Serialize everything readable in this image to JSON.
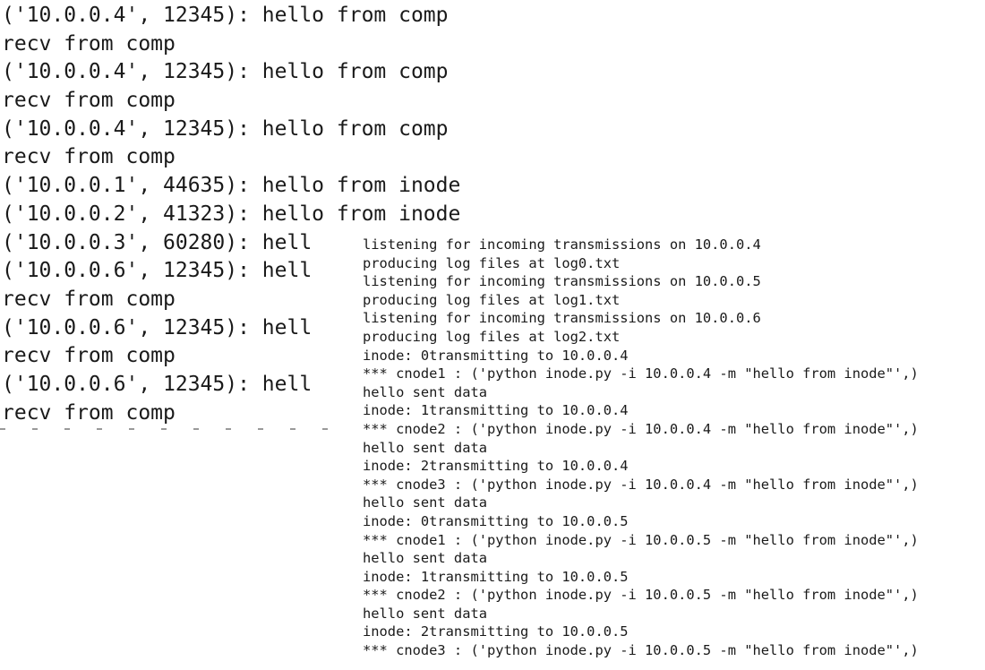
{
  "left_terminal": {
    "lines": [
      "('10.0.0.4', 12345): hello from comp",
      "recv from comp",
      "('10.0.0.4', 12345): hello from comp",
      "recv from comp",
      "('10.0.0.4', 12345): hello from comp",
      "recv from comp",
      "('10.0.0.1', 44635): hello from inode",
      "('10.0.0.2', 41323): hello from inode",
      "('10.0.0.3', 60280): hell",
      "('10.0.0.6', 12345): hell",
      "recv from comp",
      "('10.0.0.6', 12345): hell",
      "recv from comp",
      "('10.0.0.6', 12345): hell",
      "recv from comp"
    ]
  },
  "right_terminal": {
    "lines": [
      "listening for incoming transmissions on 10.0.0.4",
      "producing log files at log0.txt",
      "listening for incoming transmissions on 10.0.0.5",
      "producing log files at log1.txt",
      "listening for incoming transmissions on 10.0.0.6",
      "producing log files at log2.txt",
      "inode: 0transmitting to 10.0.0.4",
      "*** cnode1 : ('python inode.py -i 10.0.0.4 -m \"hello from inode\"',)",
      "hello sent data",
      "inode: 1transmitting to 10.0.0.4",
      "*** cnode2 : ('python inode.py -i 10.0.0.4 -m \"hello from inode\"',)",
      "hello sent data",
      "inode: 2transmitting to 10.0.0.4",
      "*** cnode3 : ('python inode.py -i 10.0.0.4 -m \"hello from inode\"',)",
      "hello sent data",
      "inode: 0transmitting to 10.0.0.5",
      "*** cnode1 : ('python inode.py -i 10.0.0.5 -m \"hello from inode\"',)",
      "hello sent data",
      "inode: 1transmitting to 10.0.0.5",
      "*** cnode2 : ('python inode.py -i 10.0.0.5 -m \"hello from inode\"',)",
      "hello sent data",
      "inode: 2transmitting to 10.0.0.5",
      "*** cnode3 : ('python inode.py -i 10.0.0.5 -m \"hello from inode\"',)"
    ]
  }
}
